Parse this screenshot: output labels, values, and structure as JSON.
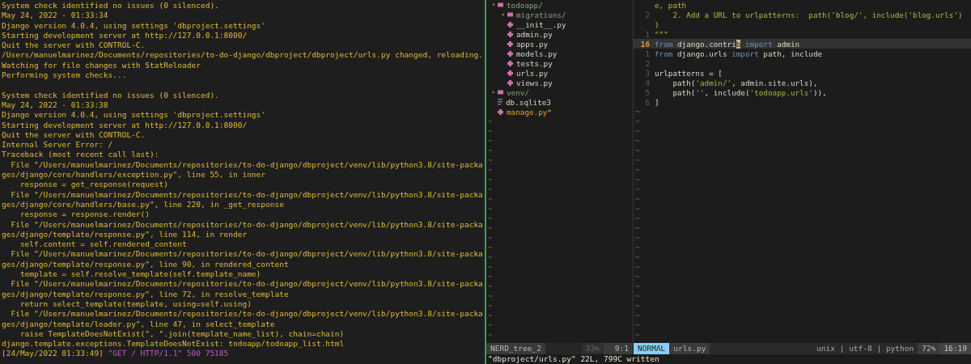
{
  "terminal": {
    "lines": [
      {
        "kind": "text",
        "segments": [
          {
            "kind": "plain",
            "text": "System check identified no issues (0 silenced)."
          }
        ]
      },
      {
        "kind": "text",
        "segments": [
          {
            "kind": "plain",
            "text": "May 24, 2022 - 01:33:34"
          }
        ]
      },
      {
        "kind": "text",
        "segments": [
          {
            "kind": "plain",
            "text": "Django version 4.0.4, using settings 'dbproject.settings'"
          }
        ]
      },
      {
        "kind": "text",
        "segments": [
          {
            "kind": "plain",
            "text": "Starting development server at http://127.0.0.1:8000/"
          }
        ]
      },
      {
        "kind": "text",
        "segments": [
          {
            "kind": "plain",
            "text": "Quit the server with CONTROL-C."
          }
        ]
      },
      {
        "kind": "text",
        "segments": [
          {
            "kind": "plain",
            "text": "/Users/manuelmarinez/Documents/repositories/to-do-django/dbproject/dbproject/urls.py changed, reloading."
          }
        ]
      },
      {
        "kind": "text",
        "segments": [
          {
            "kind": "plain",
            "text": "Watching for file changes with StatReloader"
          }
        ]
      },
      {
        "kind": "text",
        "segments": [
          {
            "kind": "plain",
            "text": "Performing system checks..."
          }
        ]
      },
      {
        "kind": "blank"
      },
      {
        "kind": "text",
        "segments": [
          {
            "kind": "plain",
            "text": "System check identified no issues (0 silenced)."
          }
        ]
      },
      {
        "kind": "text",
        "segments": [
          {
            "kind": "plain",
            "text": "May 24, 2022 - 01:33:38"
          }
        ]
      },
      {
        "kind": "text",
        "segments": [
          {
            "kind": "plain",
            "text": "Django version 4.0.4, using settings 'dbproject.settings'"
          }
        ]
      },
      {
        "kind": "text",
        "segments": [
          {
            "kind": "plain",
            "text": "Starting development server at http://127.0.0.1:8000/"
          }
        ]
      },
      {
        "kind": "text",
        "segments": [
          {
            "kind": "plain",
            "text": "Quit the server with CONTROL-C."
          }
        ]
      },
      {
        "kind": "text",
        "segments": [
          {
            "kind": "plain",
            "text": "Internal Server Error: /"
          }
        ]
      },
      {
        "kind": "text",
        "segments": [
          {
            "kind": "plain",
            "text": "Traceback (most recent call last):"
          }
        ]
      },
      {
        "kind": "text",
        "segments": [
          {
            "kind": "plain",
            "text": "  File \"/Users/manuelmarinez/Documents/repositories/to-do-django/dbproject/venv/lib/python3.8/site-packa"
          }
        ]
      },
      {
        "kind": "text",
        "segments": [
          {
            "kind": "plain",
            "text": "ges/django/core/handlers/exception.py\", line 55, in inner"
          }
        ]
      },
      {
        "kind": "text",
        "segments": [
          {
            "kind": "plain",
            "text": "    response = get_response(request)"
          }
        ]
      },
      {
        "kind": "text",
        "segments": [
          {
            "kind": "plain",
            "text": "  File \"/Users/manuelmarinez/Documents/repositories/to-do-django/dbproject/venv/lib/python3.8/site-packa"
          }
        ]
      },
      {
        "kind": "text",
        "segments": [
          {
            "kind": "plain",
            "text": "ges/django/core/handlers/base.py\", line 220, in _get_response"
          }
        ]
      },
      {
        "kind": "text",
        "segments": [
          {
            "kind": "plain",
            "text": "    response = response.render()"
          }
        ]
      },
      {
        "kind": "text",
        "segments": [
          {
            "kind": "plain",
            "text": "  File \"/Users/manuelmarinez/Documents/repositories/to-do-django/dbproject/venv/lib/python3.8/site-packa"
          }
        ]
      },
      {
        "kind": "text",
        "segments": [
          {
            "kind": "plain",
            "text": "ges/django/template/response.py\", line 114, in render"
          }
        ]
      },
      {
        "kind": "text",
        "segments": [
          {
            "kind": "plain",
            "text": "    self.content = self.rendered_content"
          }
        ]
      },
      {
        "kind": "text",
        "segments": [
          {
            "kind": "plain",
            "text": "  File \"/Users/manuelmarinez/Documents/repositories/to-do-django/dbproject/venv/lib/python3.8/site-packa"
          }
        ]
      },
      {
        "kind": "text",
        "segments": [
          {
            "kind": "plain",
            "text": "ges/django/template/response.py\", line 90, in rendered_content"
          }
        ]
      },
      {
        "kind": "text",
        "segments": [
          {
            "kind": "plain",
            "text": "    template = self.resolve_template(self.template_name)"
          }
        ]
      },
      {
        "kind": "text",
        "segments": [
          {
            "kind": "plain",
            "text": "  File \"/Users/manuelmarinez/Documents/repositories/to-do-django/dbproject/venv/lib/python3.8/site-packa"
          }
        ]
      },
      {
        "kind": "text",
        "segments": [
          {
            "kind": "plain",
            "text": "ges/django/template/response.py\", line 72, in resolve_template"
          }
        ]
      },
      {
        "kind": "text",
        "segments": [
          {
            "kind": "plain",
            "text": "    return select_template(template, using=self.using)"
          }
        ]
      },
      {
        "kind": "text",
        "segments": [
          {
            "kind": "plain",
            "text": "  File \"/Users/manuelmarinez/Documents/repositories/to-do-django/dbproject/venv/lib/python3.8/site-packa"
          }
        ]
      },
      {
        "kind": "text",
        "segments": [
          {
            "kind": "plain",
            "text": "ges/django/template/loader.py\", line 47, in select_template"
          }
        ]
      },
      {
        "kind": "text",
        "segments": [
          {
            "kind": "plain",
            "text": "    raise TemplateDoesNotExist(\", \".join(template_name_list), chain=chain)"
          }
        ]
      },
      {
        "kind": "text",
        "segments": [
          {
            "kind": "plain",
            "text": "django.template.exceptions.TemplateDoesNotExist: todoapp/todoapp_list.html"
          }
        ]
      },
      {
        "kind": "text",
        "segments": [
          {
            "kind": "plain",
            "text": "[24/May/2022 01:33:49] "
          },
          {
            "kind": "request",
            "text": "\"GET / HTTP/1.1\" 500 75185"
          }
        ]
      }
    ]
  },
  "file_tree": {
    "items": [
      {
        "name": "todoapp/",
        "kind": "folder",
        "arrow": "▾",
        "modified": false,
        "children": [
          {
            "name": "migrations/",
            "kind": "folder",
            "arrow": "▸",
            "modified": false
          },
          {
            "name": "__init__.py",
            "kind": "file",
            "modified": false
          },
          {
            "name": "admin.py",
            "kind": "file",
            "modified": false
          },
          {
            "name": "apps.py",
            "kind": "file",
            "modified": false
          },
          {
            "name": "models.py",
            "kind": "file",
            "modified": false
          },
          {
            "name": "tests.py",
            "kind": "file",
            "modified": false
          },
          {
            "name": "urls.py",
            "kind": "file",
            "modified": false
          },
          {
            "name": "views.py",
            "kind": "file",
            "modified": false
          }
        ]
      },
      {
        "name": "venv/",
        "kind": "folder",
        "arrow": "▸",
        "modified": false
      },
      {
        "name": "db.sqlite3",
        "kind": "data",
        "modified": false
      },
      {
        "name": "manage.py*",
        "kind": "file",
        "modified": true
      }
    ],
    "empty_lines": [
      "~",
      "~",
      "~",
      "~",
      "~",
      "~",
      "~",
      "~",
      "~",
      "~",
      "~",
      "~",
      "~",
      "~",
      "~",
      "~",
      "~",
      "~",
      "~",
      "~",
      "~",
      "~",
      "~"
    ]
  },
  "editor": {
    "lines": [
      {
        "current": false,
        "segments": [
          {
            "kind": "comment",
            "text": "e, path"
          }
        ]
      },
      {
        "number": "2",
        "current": false,
        "segments": [
          {
            "kind": "comment",
            "text": "    2. Add a URL to urlpatterns:  path('blog/', include('blog.urls')"
          }
        ]
      },
      {
        "current": false,
        "segments": [
          {
            "kind": "comment",
            "text": ")"
          }
        ]
      },
      {
        "number": "1",
        "current": false,
        "segments": [
          {
            "kind": "comment",
            "text": "\"\"\""
          }
        ]
      },
      {
        "number": "16",
        "current": true,
        "segments": [
          {
            "kind": "keyword",
            "text": "from"
          },
          {
            "kind": "text",
            "text": " django.contri"
          },
          {
            "kind": "cursor",
            "text": "b"
          },
          {
            "kind": "keyword",
            "text": " import"
          },
          {
            "kind": "text",
            "text": " admin"
          }
        ]
      },
      {
        "number": "1",
        "current": false,
        "segments": [
          {
            "kind": "keyword",
            "text": "from"
          },
          {
            "kind": "text",
            "text": " django.urls"
          },
          {
            "kind": "keyword",
            "text": " import"
          },
          {
            "kind": "text",
            "text": " path, include"
          }
        ]
      },
      {
        "number": "2",
        "current": false
      },
      {
        "number": "3",
        "current": false,
        "segments": [
          {
            "kind": "text",
            "text": "urlpatterns = ["
          }
        ]
      },
      {
        "number": "4",
        "current": false,
        "segments": [
          {
            "kind": "text",
            "text": "    path("
          },
          {
            "kind": "string",
            "text": "'admin/'"
          },
          {
            "kind": "text",
            "text": ", admin.site.urls),"
          }
        ]
      },
      {
        "number": "5",
        "current": false,
        "segments": [
          {
            "kind": "text",
            "text": "    path("
          },
          {
            "kind": "string",
            "text": "''"
          },
          {
            "kind": "text",
            "text": ", include("
          },
          {
            "kind": "string",
            "text": "'todoapp.urls'"
          },
          {
            "kind": "text",
            "text": ")),"
          }
        ]
      },
      {
        "number": "6",
        "current": false,
        "segments": [
          {
            "kind": "text",
            "text": "]"
          }
        ]
      }
    ],
    "empty_lines": [
      "~",
      "~",
      "~",
      "~",
      "~",
      "~",
      "~",
      "~",
      "~",
      "~",
      "~",
      "~",
      "~",
      "~",
      "~",
      "~",
      "~",
      "~",
      "~",
      "~",
      "~",
      "~",
      "~",
      "~"
    ]
  },
  "status_bar": {
    "tree": {
      "name": "NERD_tree_2",
      "percent": "33%",
      "position": "9:1"
    },
    "editor": {
      "mode": "NORMAL",
      "file": "urls.py",
      "format": "unix | utf-8 | python",
      "percent": "72%",
      "position": "16:19"
    }
  },
  "command_line": "\"dbproject/urls.py\" 22L, 799C written"
}
